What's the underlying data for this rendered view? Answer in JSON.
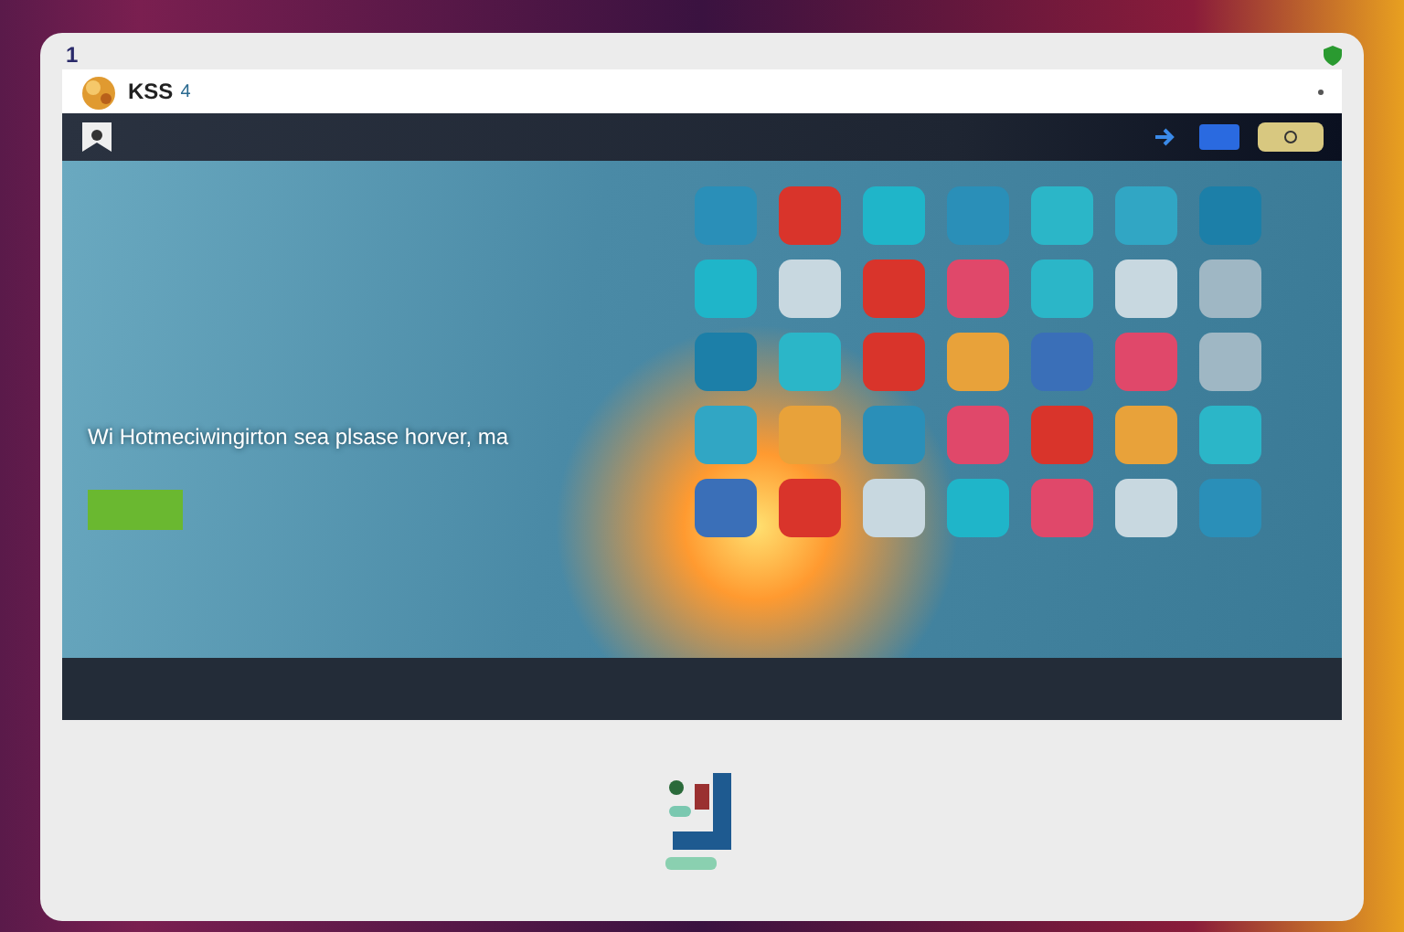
{
  "browser": {
    "tab_number": "1"
  },
  "address_bar": {
    "site_name": "KSS",
    "badge": "4"
  },
  "hero": {
    "subtitle": "Wi Hotmeciwingirton sea plsase horver, ma"
  },
  "app_grid": {
    "tiles": [
      {
        "color": "#2a8fb8"
      },
      {
        "color": "#d9342b"
      },
      {
        "color": "#1fb5c9"
      },
      {
        "color": "#2a8fb8"
      },
      {
        "color": "#2bb6c8"
      },
      {
        "color": "#31a6c4"
      },
      {
        "color": "#1c7fa8"
      },
      {
        "color": "#1fb5c9"
      },
      {
        "color": "#c8d8e0"
      },
      {
        "color": "#d9342b"
      },
      {
        "color": "#e0486a"
      },
      {
        "color": "#2bb6c8"
      },
      {
        "color": "#c8d8e0"
      },
      {
        "color": "#9fb7c4"
      },
      {
        "color": "#1c7fa8"
      },
      {
        "color": "#2bb6c8"
      },
      {
        "color": "#d9342b"
      },
      {
        "color": "#e8a23a"
      },
      {
        "color": "#3a6fb8"
      },
      {
        "color": "#e0486a"
      },
      {
        "color": "#9fb7c4"
      },
      {
        "color": "#31a6c4"
      },
      {
        "color": "#e8a23a"
      },
      {
        "color": "#2a8fb8"
      },
      {
        "color": "#e0486a"
      },
      {
        "color": "#d9342b"
      },
      {
        "color": "#e8a23a"
      },
      {
        "color": "#2bb6c8"
      },
      {
        "color": "#3a6fb8"
      },
      {
        "color": "#d9342b"
      },
      {
        "color": "#c8d8e0"
      },
      {
        "color": "#1fb5c9"
      },
      {
        "color": "#e0486a"
      },
      {
        "color": "#c8d8e0"
      },
      {
        "color": "#2a8fb8"
      }
    ]
  }
}
